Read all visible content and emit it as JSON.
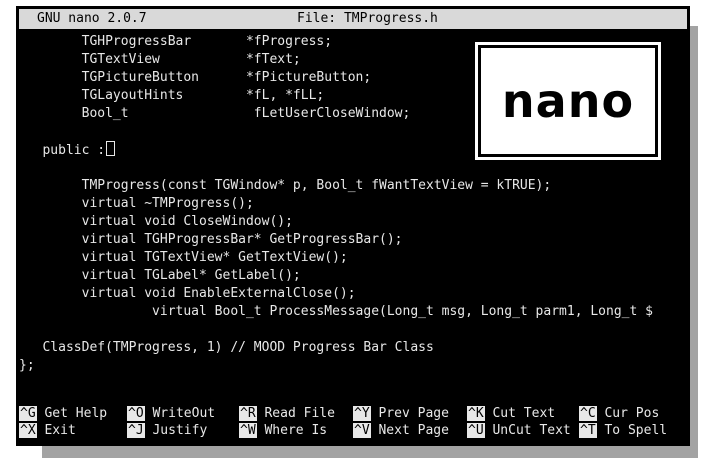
{
  "titlebar": {
    "app": "GNU nano 2.0.7",
    "file": "File: TMProgress.h"
  },
  "code_lines": [
    "        TGHProgressBar       *fProgress;",
    "        TGTextView           *fText;",
    "        TGPictureButton      *fPictureButton;",
    "        TGLayoutHints        *fL, *fLL;",
    "        Bool_t                fLetUserCloseWindow;",
    "",
    "   public :",
    "",
    "        TMProgress(const TGWindow* p, Bool_t fWantTextView = kTRUE);",
    "        virtual ~TMProgress();",
    "        virtual void CloseWindow();",
    "        virtual TGHProgressBar* GetProgressBar();",
    "        virtual TGTextView* GetTextView();",
    "        virtual TGLabel* GetLabel();",
    "        virtual void EnableExternalClose();",
    "                 virtual Bool_t ProcessMessage(Long_t msg, Long_t parm1, Long_t $",
    "",
    "   ClassDef(TMProgress, 1) // MOOD Progress Bar Class",
    "};"
  ],
  "shortcuts": [
    {
      "key": "^G",
      "label": "Get Help"
    },
    {
      "key": "^O",
      "label": "WriteOut"
    },
    {
      "key": "^R",
      "label": "Read File"
    },
    {
      "key": "^Y",
      "label": "Prev Page"
    },
    {
      "key": "^K",
      "label": "Cut Text"
    },
    {
      "key": "^C",
      "label": "Cur Pos"
    },
    {
      "key": "^X",
      "label": "Exit"
    },
    {
      "key": "^J",
      "label": "Justify"
    },
    {
      "key": "^W",
      "label": "Where Is"
    },
    {
      "key": "^V",
      "label": "Next Page"
    },
    {
      "key": "^U",
      "label": "UnCut Text"
    },
    {
      "key": "^T",
      "label": "To Spell"
    }
  ],
  "badge": {
    "text": "nano"
  },
  "colors": {
    "terminal_bg": "#000000",
    "terminal_fg": "#e8e8e8",
    "titlebar_bg": "#d9d9d9",
    "shadow": "#a3a3a3"
  }
}
